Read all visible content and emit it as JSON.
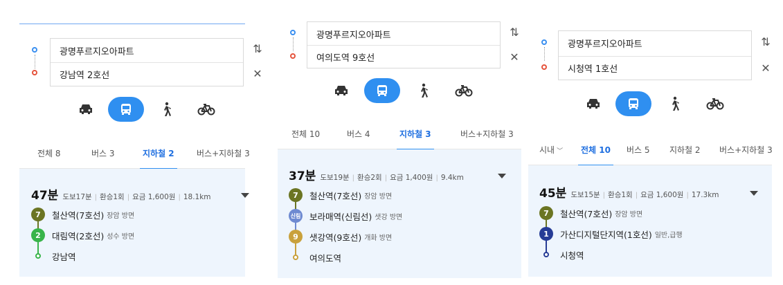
{
  "colors": {
    "accent": "#2f8ff0",
    "line7": "#6b7523",
    "line2": "#38b44a",
    "line1": "#263c96",
    "line9": "#c9a13c",
    "sillim": "#6e8ad1",
    "result_bg": "#eef5fd"
  },
  "icons": {
    "car": "car-icon",
    "bus": "bus-icon",
    "walk": "walk-icon",
    "bike": "bicycle-icon",
    "swap": "swap-icon",
    "close": "close-icon",
    "expand": "triangle-down-icon"
  },
  "panels": [
    {
      "origin": "광명푸르지오아파트",
      "destination": "강남역 2호선",
      "tabs": [
        {
          "label": "전체 8",
          "active": false
        },
        {
          "label": "버스 3",
          "active": false
        },
        {
          "label": "지하철 2",
          "active": true
        },
        {
          "label": "버스+지하철 3",
          "active": false
        }
      ],
      "summary": {
        "time": "47분",
        "walk": "도보17분",
        "transfer": "환승1회",
        "fare": "요금 1,600원",
        "distance": "18.1km"
      },
      "steps": [
        {
          "badge": "7",
          "name": "철산역(7호선)",
          "direction": "장암 방면",
          "color": "#6b7523"
        },
        {
          "badge": "2",
          "name": "대림역(2호선)",
          "direction": "성수 방면",
          "color": "#38b44a"
        },
        {
          "badge": "",
          "name": "강남역",
          "direction": "",
          "color": "#38b44a"
        }
      ]
    },
    {
      "origin": "광명푸르지오아파트",
      "destination": "여의도역 9호선",
      "tabs": [
        {
          "label": "전체 10",
          "active": false
        },
        {
          "label": "버스 4",
          "active": false
        },
        {
          "label": "지하철 3",
          "active": true
        },
        {
          "label": "버스+지하철 3",
          "active": false
        }
      ],
      "summary": {
        "time": "37분",
        "walk": "도보19분",
        "transfer": "환승2회",
        "fare": "요금 1,400원",
        "distance": "9.4km"
      },
      "steps": [
        {
          "badge": "7",
          "name": "철산역(7호선)",
          "direction": "장암 방면",
          "color": "#6b7523"
        },
        {
          "badge": "신림",
          "name": "보라매역(신림선)",
          "direction": "샛강 방면",
          "color": "#6e8ad1"
        },
        {
          "badge": "9",
          "name": "샛강역(9호선)",
          "direction": "개화 방면",
          "color": "#c9a13c"
        },
        {
          "badge": "",
          "name": "여의도역",
          "direction": "",
          "color": "#c9a13c"
        }
      ]
    },
    {
      "origin": "광명푸르지오아파트",
      "destination": "시청역 1호선",
      "filter": "시내",
      "tabs": [
        {
          "label": "전체 10",
          "active": true
        },
        {
          "label": "버스 5",
          "active": false
        },
        {
          "label": "지하철 2",
          "active": false
        },
        {
          "label": "버스+지하철 3",
          "active": false
        }
      ],
      "summary": {
        "time": "45분",
        "walk": "도보15분",
        "transfer": "환승1회",
        "fare": "요금 1,600원",
        "distance": "17.3km"
      },
      "steps": [
        {
          "badge": "7",
          "name": "철산역(7호선)",
          "direction": "장암 방면",
          "color": "#6b7523"
        },
        {
          "badge": "1",
          "name": "가산디지털단지역(1호선)",
          "direction": "일반,급행",
          "color": "#263c96"
        },
        {
          "badge": "",
          "name": "시청역",
          "direction": "",
          "color": "#263c96"
        }
      ]
    }
  ]
}
